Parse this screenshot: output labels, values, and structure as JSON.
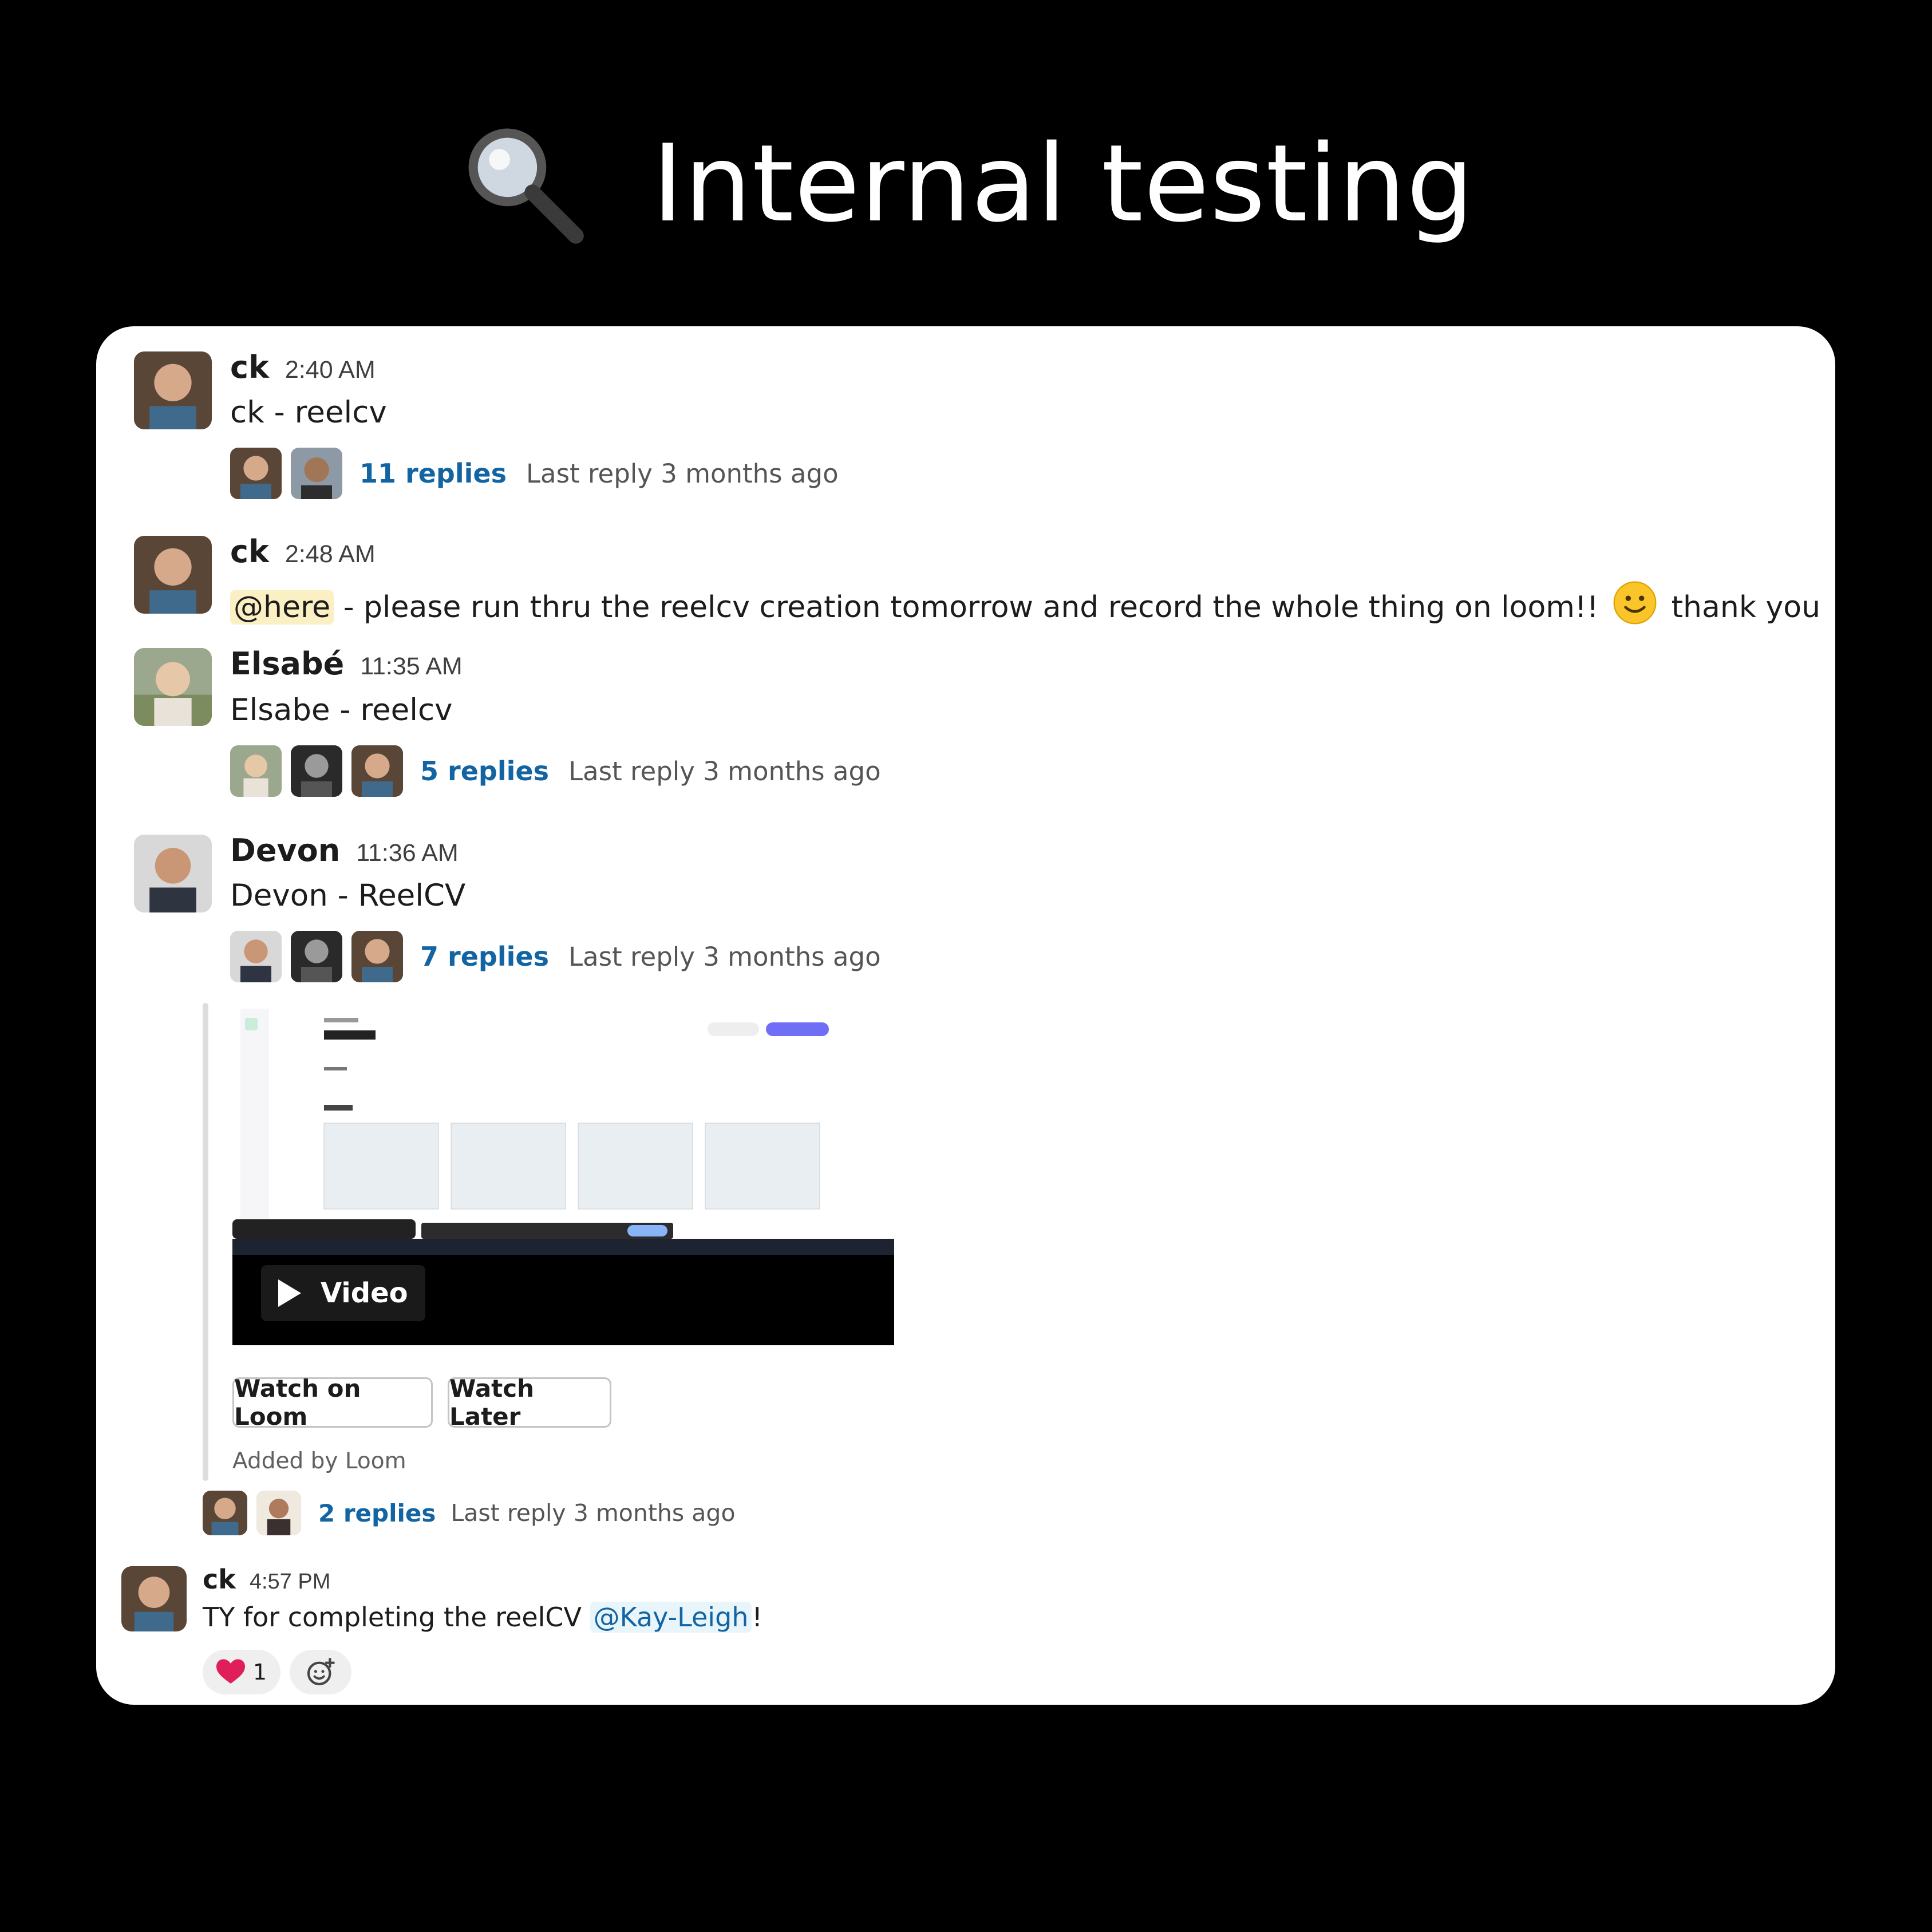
{
  "page": {
    "title": "Internal testing",
    "title_icon": "magnifying-glass-icon"
  },
  "messages": [
    {
      "name": "ck",
      "time": "2:40 AM",
      "text": "ck - reelcv",
      "thread": {
        "replies": "11 replies",
        "last_reply": "Last reply 3 months ago"
      }
    },
    {
      "name": "ck",
      "time": "2:48 AM",
      "mention": "@here",
      "text_before_emoji": " - please run thru the reelcv creation tomorrow and record the whole thing on loom!! ",
      "emoji": "slightly-smiling-face-icon",
      "text_after_emoji": " thank you"
    },
    {
      "name": "Elsabé",
      "time": "11:35 AM",
      "text": "Elsabe - reelcv",
      "thread": {
        "replies": "5 replies",
        "last_reply": "Last reply 3 months ago"
      }
    },
    {
      "name": "Devon",
      "time": "11:36 AM",
      "text": "Devon - ReelCV",
      "thread": {
        "replies": "7 replies",
        "last_reply": "Last reply 3 months ago"
      }
    }
  ],
  "attachment": {
    "video_label": "Video",
    "watch_button": "Watch on Loom",
    "later_button": "Watch Later",
    "added_by": "Added by Loom",
    "thread": {
      "replies": "2 replies",
      "last_reply": "Last reply 3 months ago"
    }
  },
  "last_message": {
    "name": "ck",
    "time": "4:57 PM",
    "text": "TY for completing the reelCV ",
    "mention": "@Kay-Leigh",
    "text_end": "!",
    "reaction": {
      "emoji": "heart-icon",
      "count": "1"
    },
    "add_reaction_icon": "add-reaction-icon"
  },
  "colors": {
    "link": "#1264a3",
    "mention_here_bg": "#fbf0c3",
    "mention_user_bg": "#e8f5fa",
    "heart": "#e01e5a"
  }
}
